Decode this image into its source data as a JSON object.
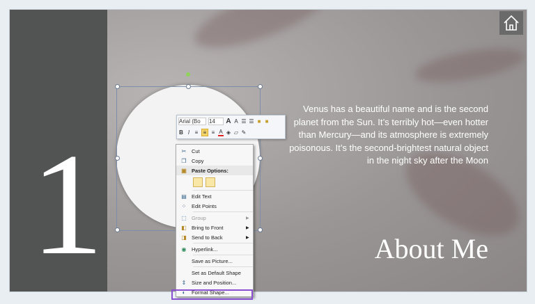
{
  "slide": {
    "number": "1",
    "body": "Venus has a beautiful name and is the second planet from the Sun. It’s terribly hot—even hotter than Mercury—and its atmosphere is extremely poisonous. It’s the second-brightest natural object in the night sky after the Moon",
    "title": "About Me"
  },
  "mini_toolbar": {
    "font": "Arial (Bo",
    "size": "14",
    "grow": "A",
    "shrink": "A",
    "bold": "B",
    "italic": "I"
  },
  "context_menu": {
    "items": [
      "Cut",
      "Copy",
      "Paste Options:",
      "Edit Text",
      "Edit Points",
      "Group",
      "Bring to Front",
      "Send to Back",
      "Hyperlink...",
      "Save as Picture...",
      "Set as Default Shape",
      "Size and Position...",
      "Format Shape..."
    ]
  },
  "colors": {
    "highlight": "#8a4fd0",
    "panel": "#525353"
  }
}
